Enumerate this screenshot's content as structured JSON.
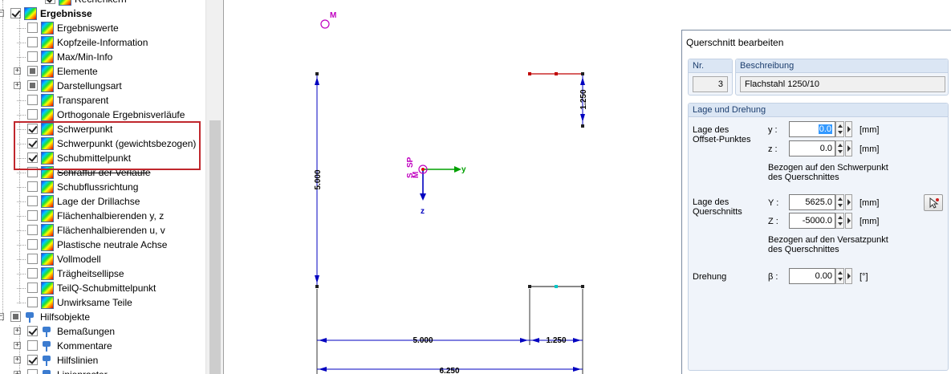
{
  "tree": {
    "items": [
      {
        "label": "Rechenkern",
        "indent": 3,
        "check": "checked",
        "icon": "contour-icon",
        "expander": "",
        "struck": false,
        "bold": false
      },
      {
        "label": "Ergebnisse",
        "indent": 1,
        "check": "checked",
        "icon": "contour-icon",
        "expander": "-",
        "struck": false,
        "bold": true
      },
      {
        "label": "Ergebniswerte",
        "indent": 2,
        "check": "unchecked",
        "icon": "contour-icon",
        "expander": "",
        "struck": false,
        "bold": false
      },
      {
        "label": "Kopfzeile-Information",
        "indent": 2,
        "check": "unchecked",
        "icon": "contour-icon",
        "expander": "",
        "struck": false,
        "bold": false
      },
      {
        "label": "Max/Min-Info",
        "indent": 2,
        "check": "unchecked",
        "icon": "contour-icon",
        "expander": "",
        "struck": false,
        "bold": false
      },
      {
        "label": "Elemente",
        "indent": 2,
        "check": "partial",
        "icon": "contour-icon",
        "expander": "+",
        "struck": false,
        "bold": false
      },
      {
        "label": "Darstellungsart",
        "indent": 2,
        "check": "partial",
        "icon": "contour-icon",
        "expander": "+",
        "struck": false,
        "bold": false
      },
      {
        "label": "Transparent",
        "indent": 2,
        "check": "unchecked",
        "icon": "contour-icon",
        "expander": "",
        "struck": false,
        "bold": false
      },
      {
        "label": "Orthogonale Ergebnisverläufe",
        "indent": 2,
        "check": "unchecked",
        "icon": "contour-icon",
        "expander": "",
        "struck": false,
        "bold": false
      },
      {
        "label": "Schwerpunkt",
        "indent": 2,
        "check": "checked",
        "icon": "contour-icon",
        "expander": "",
        "struck": false,
        "bold": false
      },
      {
        "label": "Schwerpunkt (gewichtsbezogen)",
        "indent": 2,
        "check": "checked",
        "icon": "contour-icon",
        "expander": "",
        "struck": false,
        "bold": false
      },
      {
        "label": "Schubmittelpunkt",
        "indent": 2,
        "check": "checked",
        "icon": "contour-icon",
        "expander": "",
        "struck": false,
        "bold": false
      },
      {
        "label": "Schraffur der Verläufe",
        "indent": 2,
        "check": "unchecked",
        "icon": "contour-icon",
        "expander": "",
        "struck": true,
        "bold": false
      },
      {
        "label": "Schubflussrichtung",
        "indent": 2,
        "check": "unchecked",
        "icon": "contour-icon",
        "expander": "",
        "struck": false,
        "bold": false
      },
      {
        "label": "Lage der Drillachse",
        "indent": 2,
        "check": "unchecked",
        "icon": "contour-icon",
        "expander": "",
        "struck": false,
        "bold": false
      },
      {
        "label": "Flächenhalbierenden y, z",
        "indent": 2,
        "check": "unchecked",
        "icon": "contour-icon",
        "expander": "",
        "struck": false,
        "bold": false
      },
      {
        "label": "Flächenhalbierenden u, v",
        "indent": 2,
        "check": "unchecked",
        "icon": "contour-icon",
        "expander": "",
        "struck": false,
        "bold": false
      },
      {
        "label": "Plastische neutrale Achse",
        "indent": 2,
        "check": "unchecked",
        "icon": "contour-icon",
        "expander": "",
        "struck": false,
        "bold": false
      },
      {
        "label": "Vollmodell",
        "indent": 2,
        "check": "unchecked",
        "icon": "contour-icon",
        "expander": "",
        "struck": false,
        "bold": false
      },
      {
        "label": "Trägheitsellipse",
        "indent": 2,
        "check": "unchecked",
        "icon": "contour-icon",
        "expander": "",
        "struck": false,
        "bold": false
      },
      {
        "label": "TeilQ-Schubmittelpunkt",
        "indent": 2,
        "check": "unchecked",
        "icon": "contour-icon",
        "expander": "",
        "struck": false,
        "bold": false
      },
      {
        "label": "Unwirksame Teile",
        "indent": 2,
        "check": "unchecked",
        "icon": "contour-icon",
        "expander": "",
        "struck": false,
        "bold": false
      },
      {
        "label": "Hilfsobjekte",
        "indent": 1,
        "check": "partial",
        "icon": "pin-icon",
        "expander": "-",
        "struck": false,
        "bold": false
      },
      {
        "label": "Bemaßungen",
        "indent": 2,
        "check": "checked",
        "icon": "pin-icon",
        "expander": "+",
        "struck": false,
        "bold": false
      },
      {
        "label": "Kommentare",
        "indent": 2,
        "check": "unchecked",
        "icon": "pin-icon",
        "expander": "+",
        "struck": false,
        "bold": false
      },
      {
        "label": "Hilfslinien",
        "indent": 2,
        "check": "checked",
        "icon": "pin-icon",
        "expander": "+",
        "struck": false,
        "bold": false
      },
      {
        "label": "Linienraster",
        "indent": 2,
        "check": "unchecked",
        "icon": "pin-icon",
        "expander": "+",
        "struck": false,
        "bold": false
      }
    ]
  },
  "drawing": {
    "dim_left_vertical": "5.000",
    "dim_right_vertical": "1.250",
    "dim_bottom_left": "5.000",
    "dim_bottom_right": "1.250",
    "dim_bottom_total": "6.250",
    "axis_y": "y",
    "axis_z": "z",
    "marker_top": "M",
    "marker_sp": "SP",
    "marker_s": "S",
    "marker_m": "M"
  },
  "dialog": {
    "title": "Querschnitt bearbeiten",
    "nr_header": "Nr.",
    "nr_value": "3",
    "desc_header": "Beschreibung",
    "desc_value": "Flachstahl 1250/10",
    "group_title": "Lage und Drehung",
    "offset_label_1": "Lage des",
    "offset_label_2": "Offset-Punktes",
    "y_label": "y :",
    "y_value": "0.0",
    "z_label": "z :",
    "z_value": "0.0",
    "unit_mm": "[mm]",
    "ref_sp_1": "Bezogen auf den Schwerpunkt",
    "ref_sp_2": "des Querschnittes",
    "qs_label_1": "Lage des",
    "qs_label_2": "Querschnitts",
    "Y_label": "Y :",
    "Y_value": "5625.0",
    "Z_label": "Z :",
    "Z_value": "-5000.0",
    "ref_vp_1": "Bezogen auf den Versatzpunkt",
    "ref_vp_2": "des Querschnittes",
    "rot_label": "Drehung",
    "beta_label": "β :",
    "beta_value": "0.00",
    "unit_deg": "[°]"
  }
}
